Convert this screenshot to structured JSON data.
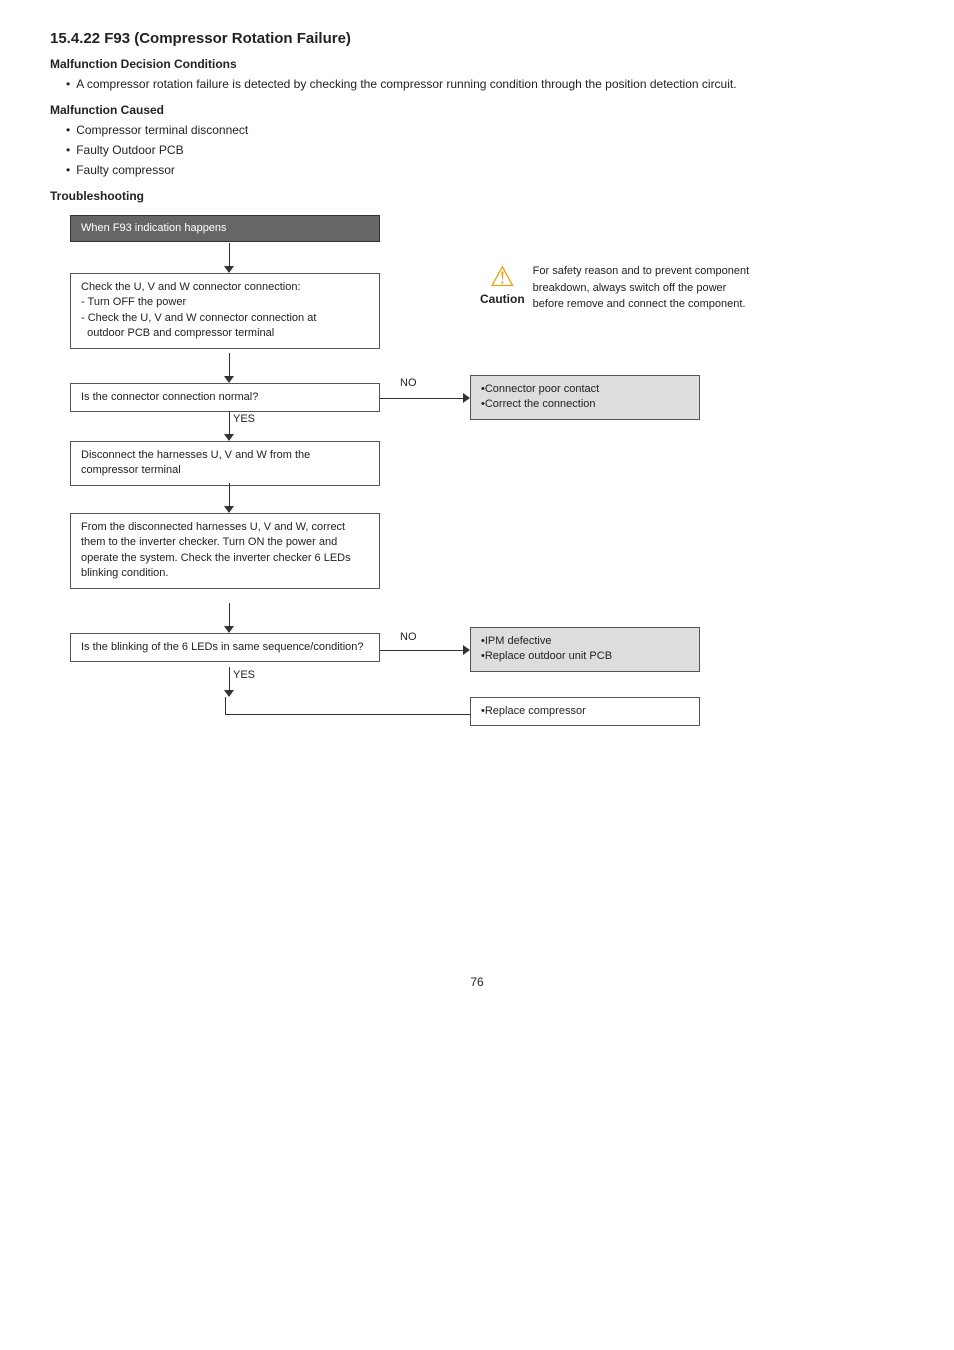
{
  "page": {
    "title": "15.4.22   F93 (Compressor Rotation Failure)",
    "page_number": "76",
    "malfunction_decision": {
      "heading": "Malfunction Decision Conditions",
      "bullets": [
        "A compressor rotation failure is detected by checking the compressor running condition through the position detection circuit."
      ]
    },
    "malfunction_caused": {
      "heading": "Malfunction Caused",
      "bullets": [
        "Compressor terminal disconnect",
        "Faulty Outdoor PCB",
        "Faulty compressor"
      ]
    },
    "troubleshooting": {
      "heading": "Troubleshooting"
    },
    "flowchart": {
      "start_box": "When F93 indication happens",
      "box1": "Check the U, V and W connector connection:\n- Turn OFF the power\n- Check the U, V and W connector connection at outdoor PCB and compressor terminal",
      "box2": "Is the connector connection normal?",
      "box3": "Disconnect the harnesses U, V and W from the compressor terminal",
      "box4": "From the disconnected harnesses U, V and W, correct them to the inverter checker. Turn ON the power and operate the system. Check the inverter checker 6 LEDs blinking condition.",
      "box5": "Is the blinking of the 6 LEDs in same sequence/condition?",
      "no_box1_title": "•Connector poor contact",
      "no_box1_sub": "•Correct the connection",
      "no_box2_title": "•IPM defective",
      "no_box2_sub": "•Replace outdoor unit PCB",
      "yes_box": "•Replace compressor",
      "label_no1": "NO",
      "label_yes1": "YES",
      "label_no2": "NO",
      "label_yes2": "YES"
    },
    "caution": {
      "label": "Caution",
      "text": "For safety reason and to prevent component breakdown, always switch off the power before remove and connect the component."
    }
  }
}
